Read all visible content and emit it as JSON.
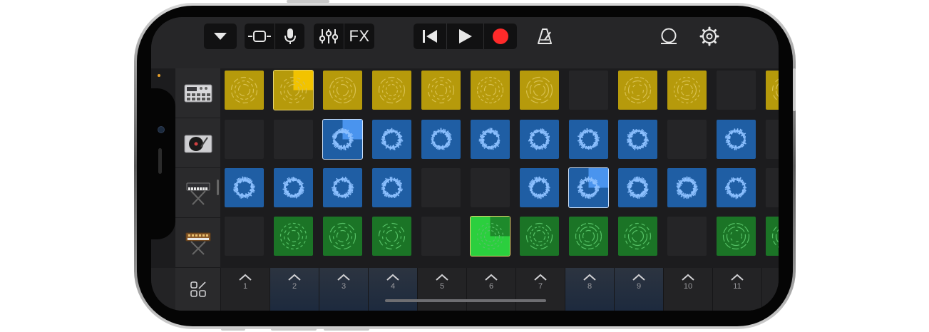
{
  "toolbar": {
    "fx_label": "FX"
  },
  "tracks": [
    {
      "name": "Drum Machine",
      "color": "#b69a0b"
    },
    {
      "name": "Turntable",
      "color": "#1f5c9e"
    },
    {
      "name": "Keyboard",
      "color": "#1f5c9e"
    },
    {
      "name": "Synth",
      "color": "#1a6b25"
    }
  ],
  "scene_triggers": [
    "1",
    "2",
    "3",
    "4",
    "5",
    "6",
    "7",
    "8",
    "9",
    "10",
    "11"
  ],
  "colors": {
    "yellow": "#b69a0b",
    "blue": "#1f5ea4",
    "green": "#1b7426",
    "record": "#ff2a2a"
  }
}
